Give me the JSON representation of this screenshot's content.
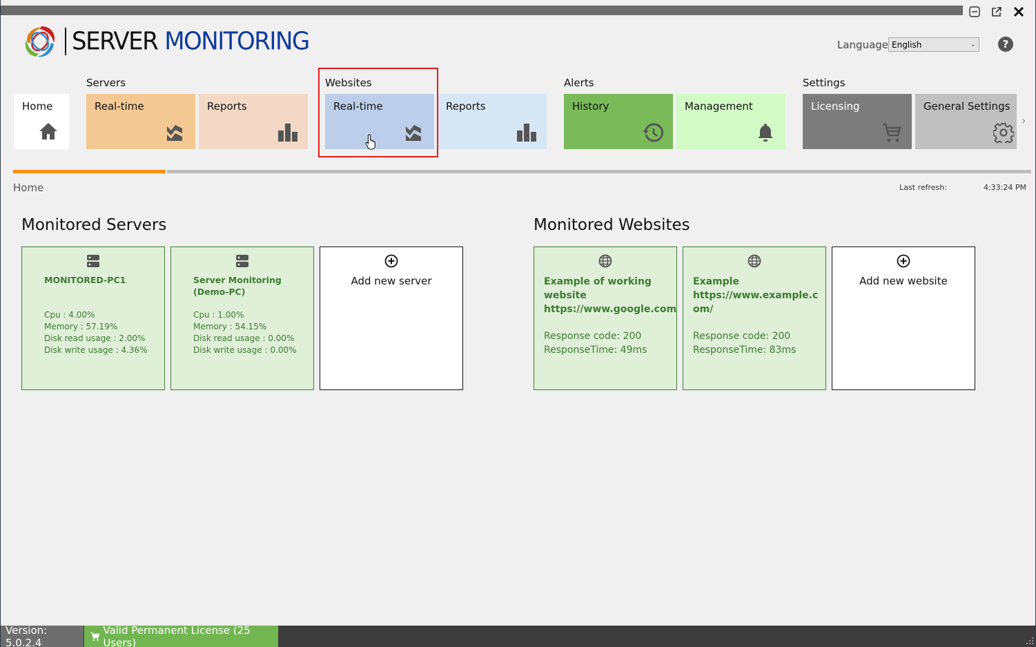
{
  "app": {
    "title_part1": "SERVER",
    "title_part2": "MONITORING"
  },
  "window_controls": {
    "minimize_icon": "minimize-icon",
    "popout_icon": "popout-icon",
    "close_icon": "close-icon"
  },
  "header": {
    "language_label": "Language",
    "language_value": "English",
    "help_label": "?"
  },
  "nav": {
    "home": {
      "label": "Home",
      "icon": "home-icon"
    },
    "groups": [
      {
        "label": "Servers",
        "tiles": [
          {
            "label": "Real-time",
            "icon": "realtime-chart-icon",
            "color": "#f3c892"
          },
          {
            "label": "Reports",
            "icon": "bar-chart-icon",
            "color": "#f3d8c6"
          }
        ]
      },
      {
        "label": "Websites",
        "tiles": [
          {
            "label": "Real-time",
            "icon": "realtime-chart-icon",
            "color": "#bccee9"
          },
          {
            "label": "Reports",
            "icon": "bar-chart-icon",
            "color": "#d6e6f4"
          }
        ]
      },
      {
        "label": "Alerts",
        "tiles": [
          {
            "label": "History",
            "icon": "history-icon",
            "color": "#7aba59"
          },
          {
            "label": "Management",
            "icon": "bell-icon",
            "color": "#d2fbc5"
          }
        ]
      },
      {
        "label": "Settings",
        "tiles": [
          {
            "label": "Licensing",
            "icon": "cart-icon",
            "color": "#7c7c7c"
          },
          {
            "label": "General Settings",
            "icon": "gear-icon",
            "color": "#c0c0c0"
          }
        ]
      }
    ]
  },
  "refresh_progress": 0.15,
  "breadcrumb": "Home",
  "last_refresh": {
    "label": "Last refresh:",
    "time": "4:33:24 PM"
  },
  "servers": {
    "title": "Monitored Servers",
    "items": [
      {
        "name": "MONITORED-PC1",
        "cpu": "Cpu : 4.00%",
        "memory": "Memory : 57.19%",
        "disk_read": "Disk read usage : 2.00%",
        "disk_write": "Disk write usage : 4.36%"
      },
      {
        "name": "Server Monitoring (Demo-PC)",
        "cpu": "Cpu : 1.00%",
        "memory": "Memory : 54.15%",
        "disk_read": "Disk read usage : 0.00%",
        "disk_write": "Disk write usage : 0.00%"
      }
    ],
    "add_label": "Add new server"
  },
  "websites": {
    "title": "Monitored Websites",
    "items": [
      {
        "name": "Example of working website",
        "url": "https://www.google.com",
        "response_code": "Response code: 200",
        "response_time": "ResponseTime: 49ms"
      },
      {
        "name": "Example",
        "url": "https://www.example.com/",
        "response_code": "Response code: 200",
        "response_time": "ResponseTime: 83ms"
      }
    ],
    "add_label": "Add new website"
  },
  "statusbar": {
    "version": "Version: 5.0.2.4",
    "license": "Valid Permanent License (25 Users)"
  },
  "colors": {
    "accent_orange": "#f7920f",
    "card_green_bg": "#dfefd8",
    "card_green_text": "#3e7b32",
    "logo_blue": "#0e3b9c",
    "highlight_red": "#e41b1b",
    "license_green": "#72b652"
  }
}
